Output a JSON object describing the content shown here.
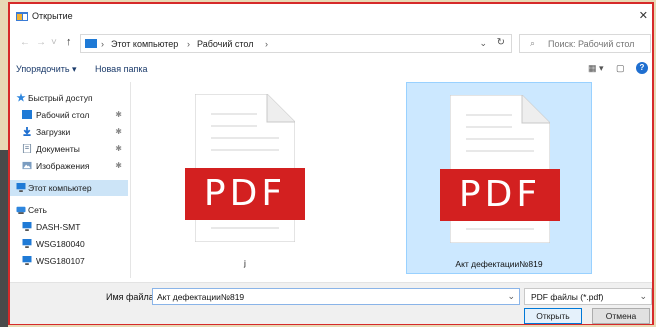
{
  "dialog": {
    "title": "Открытие",
    "close": "✕"
  },
  "nav": {
    "back": "←",
    "forward": "→",
    "recent": "˅",
    "up": "↑",
    "crumbs": [
      "Этот компьютер",
      "Рабочий стол"
    ],
    "sep": "›",
    "dropdown": "⌄",
    "refresh": "↻",
    "search_icon": "⌕",
    "search_placeholder": "Поиск: Рабочий стол"
  },
  "toolbar": {
    "organize": "Упорядочить ▾",
    "new_folder": "Новая папка",
    "view": "▦ ▾",
    "pane": "▢",
    "help": "?"
  },
  "sidebar": {
    "items": [
      {
        "label": "Быстрый доступ",
        "icon": "star-icon",
        "pin": ""
      },
      {
        "label": "Рабочий стол",
        "icon": "desktop-icon",
        "pin": "✱"
      },
      {
        "label": "Загрузки",
        "icon": "download-icon",
        "pin": "✱"
      },
      {
        "label": "Документы",
        "icon": "document-icon",
        "pin": "✱"
      },
      {
        "label": "Изображения",
        "icon": "pictures-icon",
        "pin": "✱"
      },
      {
        "label": "Этот компьютер",
        "icon": "computer-icon",
        "pin": ""
      },
      {
        "label": "Сеть",
        "icon": "network-icon",
        "pin": ""
      },
      {
        "label": "DASH-SMT",
        "icon": "computer-icon",
        "pin": ""
      },
      {
        "label": "WSG180040",
        "icon": "computer-icon",
        "pin": ""
      },
      {
        "label": "WSG180107",
        "icon": "computer-icon",
        "pin": ""
      }
    ]
  },
  "files": [
    {
      "name": "j",
      "badge": "PDF"
    },
    {
      "name": "Акт дефектации№819",
      "badge": "PDF"
    }
  ],
  "bottom": {
    "filename_label": "Имя файла:",
    "filename_value": "Акт дефектации№819",
    "filter": "PDF файлы (*.pdf)",
    "open": "Открыть",
    "cancel": "Отмена"
  },
  "colors": {
    "accent": "#0078d7",
    "pdf_red": "#d32020",
    "selected": "#cce8ff",
    "frame": "#d62a2a"
  }
}
